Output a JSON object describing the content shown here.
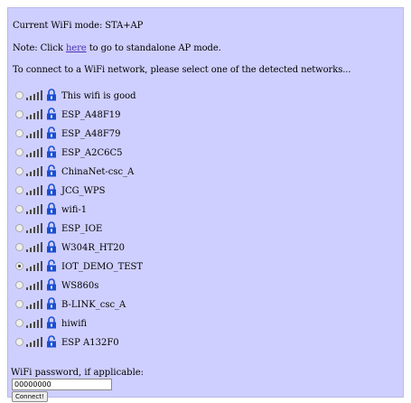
{
  "mode_line": "Current WiFi mode: STA+AP",
  "note": {
    "prefix": "Note: Click ",
    "link": "here",
    "suffix": " to go to standalone AP mode."
  },
  "instruction": "To connect to a WiFi network, please select one of the detected networks...",
  "networks": [
    {
      "ssid": "This wifi is good",
      "locked": true,
      "selected": false
    },
    {
      "ssid": "ESP_A48F19",
      "locked": false,
      "selected": false
    },
    {
      "ssid": "ESP_A48F79",
      "locked": false,
      "selected": false
    },
    {
      "ssid": "ESP_A2C6C5",
      "locked": false,
      "selected": false
    },
    {
      "ssid": "ChinaNet-csc_A",
      "locked": false,
      "selected": false
    },
    {
      "ssid": "JCG_WPS",
      "locked": true,
      "selected": false
    },
    {
      "ssid": "wifi-1",
      "locked": true,
      "selected": false
    },
    {
      "ssid": "ESP_IOE",
      "locked": true,
      "selected": false
    },
    {
      "ssid": "W304R_HT20",
      "locked": true,
      "selected": false
    },
    {
      "ssid": "IOT_DEMO_TEST",
      "locked": false,
      "selected": true
    },
    {
      "ssid": "WS860s",
      "locked": true,
      "selected": false
    },
    {
      "ssid": "B-LINK_csc_A",
      "locked": true,
      "selected": false
    },
    {
      "ssid": "hiwifi",
      "locked": true,
      "selected": false
    },
    {
      "ssid": "ESP A132F0",
      "locked": false,
      "selected": false
    }
  ],
  "password": {
    "label": "WiFi password, if applicable:",
    "value": "00000000"
  },
  "connect_label": "Connect!",
  "colors": {
    "panel": "#cfcfff",
    "link": "#4a2fb0",
    "lock": "#1a4fd0",
    "signal": "#4a4a4a"
  }
}
